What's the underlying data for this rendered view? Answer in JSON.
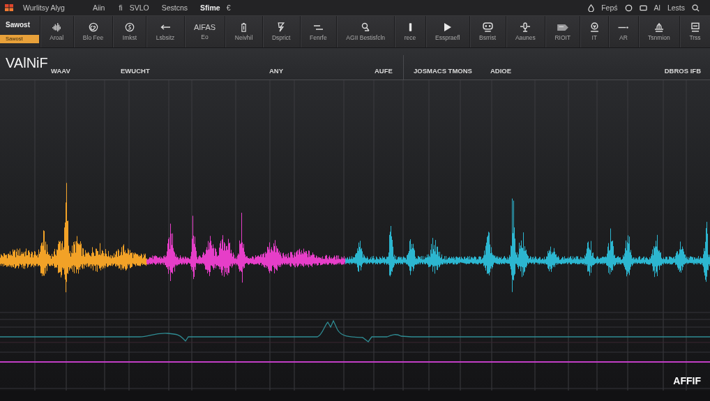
{
  "menu_bar": {
    "items": [
      "Wurlitsy Alyg",
      "Aiin",
      "fi",
      "SVLO",
      "Sestcns",
      "Sfime",
      "€"
    ],
    "right_texts": [
      "Fepś",
      "Al",
      "Lests"
    ]
  },
  "toolbar": {
    "mode_title": "Sawost",
    "mode_button": "Sawost",
    "tools": [
      {
        "kind": "icon",
        "label": "Aroal"
      },
      {
        "kind": "icon",
        "label": "Blo Fee"
      },
      {
        "kind": "icon",
        "label": "Imkst"
      },
      {
        "kind": "icon",
        "label": "Lsbsitz"
      },
      {
        "kind": "text",
        "title": "AIFAS",
        "label": "Eo"
      },
      {
        "kind": "icon",
        "label": "Neivhil"
      },
      {
        "kind": "icon",
        "label": "Dsprict"
      },
      {
        "kind": "icon",
        "label": "Fenrfe"
      },
      {
        "kind": "icon",
        "label": "AGII Bestisfcln"
      },
      {
        "kind": "icon",
        "label": "rece"
      },
      {
        "kind": "icon",
        "label": "Esspraefl"
      },
      {
        "kind": "icon",
        "label": "Bsrrist"
      },
      {
        "kind": "icon",
        "label": "Aaunes"
      },
      {
        "kind": "icon",
        "label": "RIOIT"
      },
      {
        "kind": "icon",
        "label": "IT"
      },
      {
        "kind": "icon",
        "label": "AR"
      },
      {
        "kind": "icon",
        "label": "Tsnmion"
      },
      {
        "kind": "icon",
        "label": "Trss"
      }
    ]
  },
  "track_header": {
    "title": "VAlNiF",
    "columns": [
      "WAAV",
      "EWUCHT",
      "ANY",
      "AUFE",
      "JOSMACS TMONS",
      "ADIOE",
      "DBROS IFB"
    ]
  },
  "waveform": {
    "segments": [
      {
        "color": "#f2a227"
      },
      {
        "color": "#e63ec8"
      },
      {
        "color": "#2cb6d0"
      }
    ]
  },
  "corner_label": "AFFIF"
}
